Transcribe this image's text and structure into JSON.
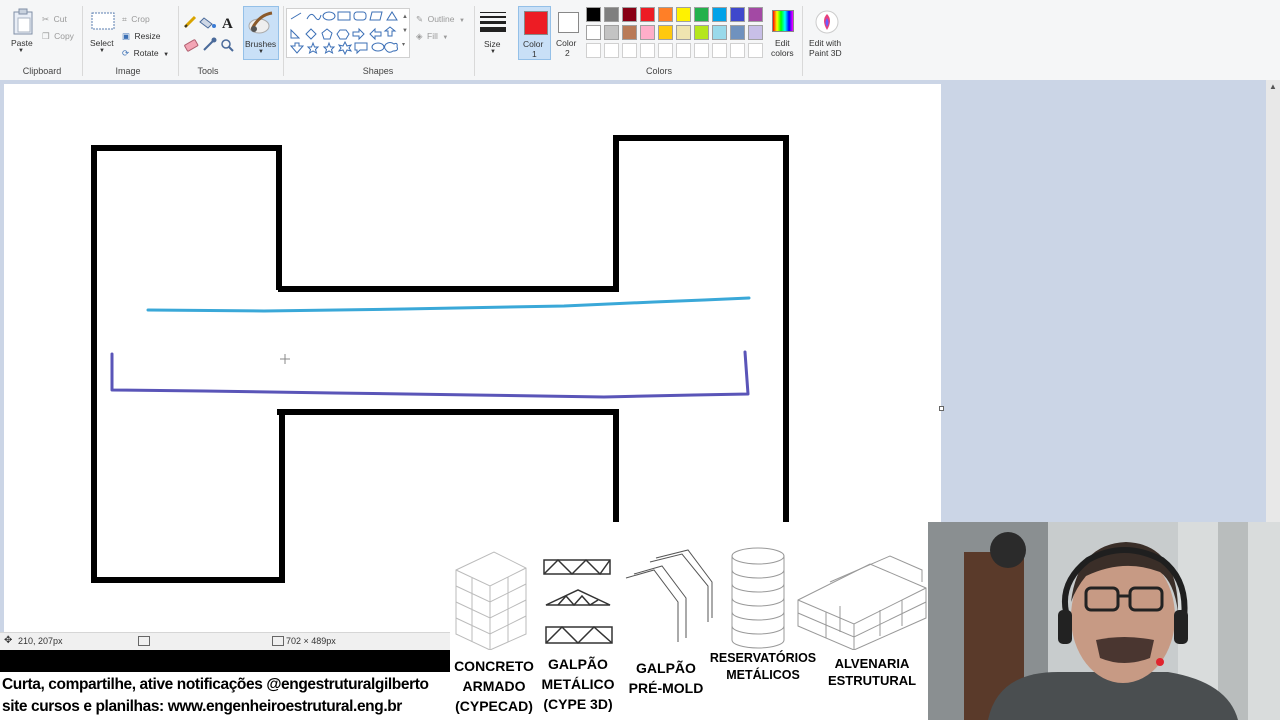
{
  "ribbon": {
    "clipboard": {
      "paste": "Paste",
      "cut": "Cut",
      "copy": "Copy",
      "label": "Clipboard"
    },
    "image": {
      "select": "Select",
      "crop": "Crop",
      "resize": "Resize",
      "rotate": "Rotate",
      "label": "Image"
    },
    "tools": {
      "label": "Tools"
    },
    "brushes": "Brushes",
    "shapes": {
      "outline": "Outline",
      "fill": "Fill",
      "label": "Shapes"
    },
    "size": "Size",
    "color1": {
      "line1": "Color",
      "line2": "1",
      "value": "#ed1c24"
    },
    "color2": {
      "line1": "Color",
      "line2": "2",
      "value": "#ffffff"
    },
    "colors_label": "Colors",
    "edit_colors": {
      "line1": "Edit",
      "line2": "colors"
    },
    "paint3d": {
      "line1": "Edit with",
      "line2": "Paint 3D"
    },
    "palette_row1": [
      "#000000",
      "#7f7f7f",
      "#880015",
      "#ed1c24",
      "#ff7f27",
      "#fff200",
      "#22b14c",
      "#00a2e8",
      "#3f48cc",
      "#a349a4"
    ],
    "palette_row2": [
      "#ffffff",
      "#c3c3c3",
      "#b97a57",
      "#ffaec9",
      "#ffc90e",
      "#efe4b0",
      "#b5e61d",
      "#99d9ea",
      "#7092be",
      "#c8bfe7"
    ]
  },
  "status": {
    "cursor": "210, 207px",
    "size": "702 × 489px"
  },
  "promo": {
    "line1": "Curta, compartilhe, ative notificações @engestruturalgilberto",
    "line2": "site cursos e planilhas: www.engenheiroestrutural.eng.br"
  },
  "logos": [
    {
      "line1": "CONCRETO",
      "line2": "ARMADO",
      "line3": "(CYPECAD)"
    },
    {
      "line1": "GALPÃO",
      "line2": "METÁLICO",
      "line3": "(CYPE 3D)"
    },
    {
      "line1": "GALPÃO",
      "line2": "PRÉ-MOLD"
    },
    {
      "line1": "RESERVATÓRIOS",
      "line2": "METÁLICOS"
    },
    {
      "line1": "ALVENARIA",
      "line2": "ESTRUTURAL"
    }
  ],
  "drawing": {
    "line_colors": {
      "outline": "#000000",
      "blue": "#3aa8d8",
      "purple": "#5a55b8"
    }
  }
}
